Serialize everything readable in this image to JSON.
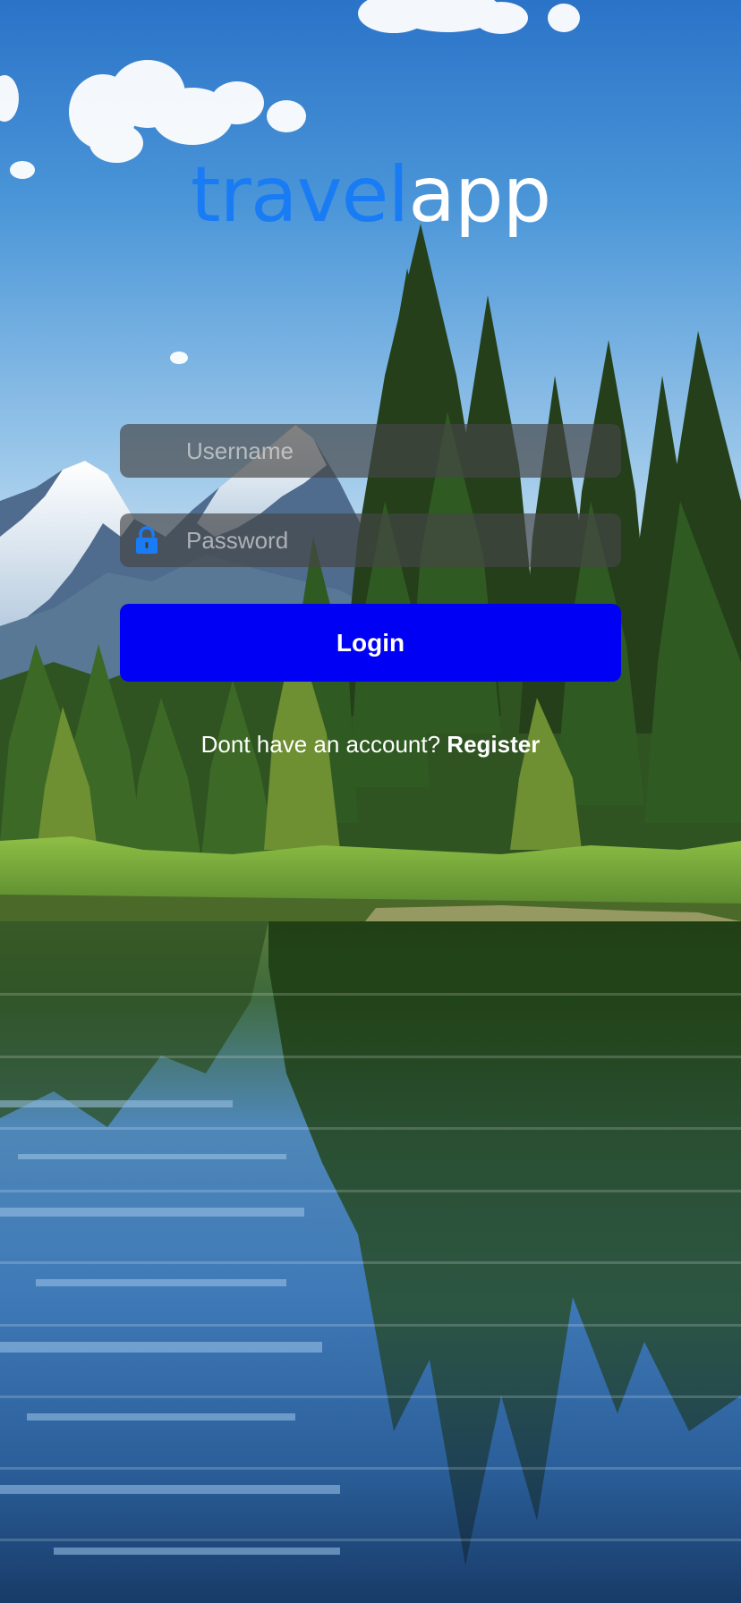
{
  "app": {
    "logo_part_1": "travel",
    "logo_part_2": "app"
  },
  "form": {
    "username_placeholder": "Username",
    "username_value": "",
    "password_placeholder": "Password",
    "password_value": "",
    "password_icon": "lock-icon",
    "login_label": "Login"
  },
  "register": {
    "prompt": "Dont have an account?",
    "link_label": "Register"
  },
  "colors": {
    "logo_accent": "#1a7cf5",
    "logo_white": "#ffffff",
    "login_button": "#0000f5",
    "field_background": "rgba(70,70,70,0.68)",
    "lock_icon": "#1a7cf5"
  }
}
